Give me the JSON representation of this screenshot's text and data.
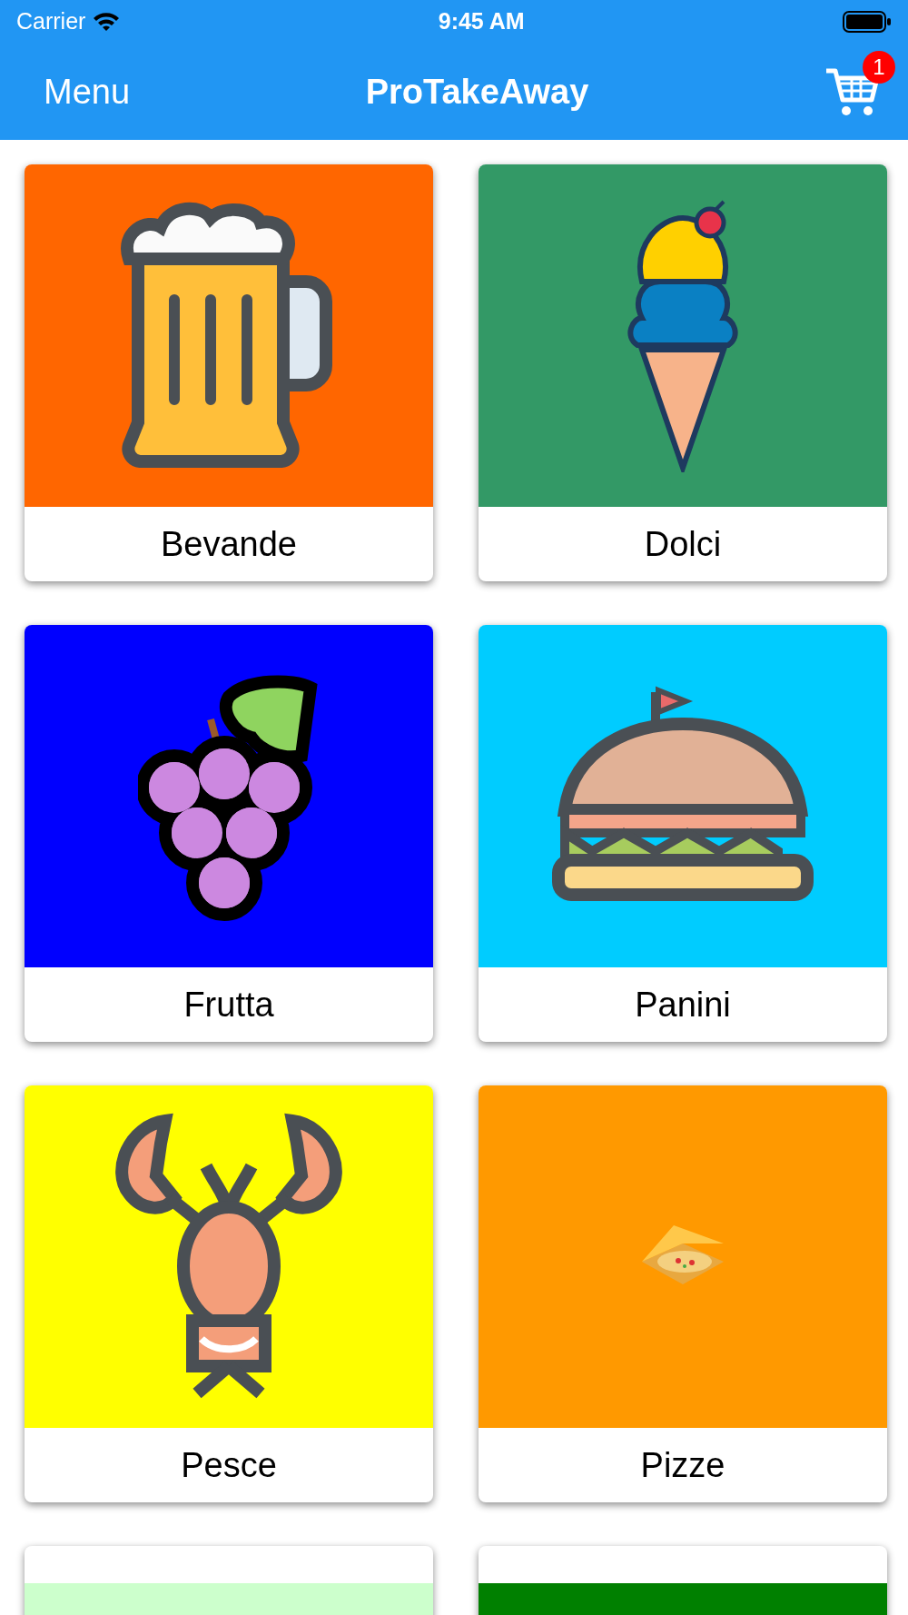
{
  "status_bar": {
    "carrier": "Carrier",
    "time": "9:45 AM"
  },
  "nav_bar": {
    "left": "Menu",
    "title": "ProTakeAway",
    "cart_count": "1"
  },
  "categories": [
    {
      "label": "Bevande",
      "color": "#ff6600"
    },
    {
      "label": "Dolci",
      "color": "#339966"
    },
    {
      "label": "Frutta",
      "color": "#0000ff"
    },
    {
      "label": "Panini",
      "color": "#00ccff"
    },
    {
      "label": "Pesce",
      "color": "#ffff00"
    },
    {
      "label": "Pizze",
      "color": "#ff9900"
    },
    {
      "color": "#ccffcc"
    },
    {
      "color": "#008000"
    }
  ]
}
